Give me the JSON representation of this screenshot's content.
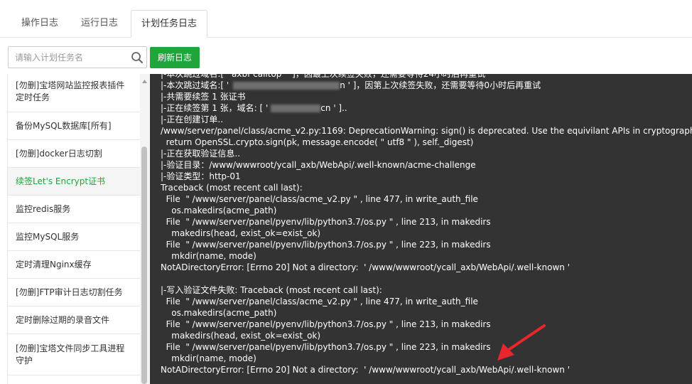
{
  "tabs": [
    {
      "label": "操作日志"
    },
    {
      "label": "运行日志"
    },
    {
      "label": "计划任务日志",
      "active": true
    }
  ],
  "search": {
    "placeholder": "请输入计划任务名",
    "icon": "search-icon"
  },
  "refresh_label": "刷新日志",
  "sidebar": {
    "items": [
      {
        "label": "[勿删]宝塔网站监控报表插件定时任务"
      },
      {
        "label": "备份MySQL数据库[所有]"
      },
      {
        "label": "[勿删]docker日志切割"
      },
      {
        "label": "续签Let's Encrypt证书",
        "selected": true
      },
      {
        "label": "监控redis服务"
      },
      {
        "label": "监控MySQL服务"
      },
      {
        "label": "定时清理Nginx缓存"
      },
      {
        "label": "[勿删]FTP审计日志切割任务"
      },
      {
        "label": "定时删除过期的录音文件"
      },
      {
        "label": "[勿删]宝塔文件同步工具进程守护"
      }
    ]
  },
  "log": {
    "lines": [
      "|-本次跳过域名:[ ' axbf calltop '  ]，因最上次续签失败，还需要等待24小时后再重试",
      "|-本次跳过域名:[ '",
      "n ' ]，因第上次续签失败，还需要等待0小时后再重试",
      "|-共需要续签 1 张证书",
      "|-正在续签第 1 张，域名: [ '",
      "cn ' ]..",
      "|-正在创建订单..",
      "/www/server/panel/class/acme_v2.py:1169: DeprecationWarning: sign() is deprecated. Use the equivilant APIs in cryptography.",
      "  return OpenSSL.crypto.sign(pk, message.encode( \" utf8 \" ), self._digest)",
      "|-正在获取验证信息..",
      "|-验证目录：/www/wwwroot/ycall_axb/WebApi/.well-known/acme-challenge",
      "|-验证类型：http-01",
      "Traceback (most recent call last):",
      "  File  \" /www/server/panel/class/acme_v2.py \" , line 477, in write_auth_file",
      "    os.makedirs(acme_path)",
      "  File  \" /www/server/panel/pyenv/lib/python3.7/os.py \" , line 213, in makedirs",
      "    makedirs(head, exist_ok=exist_ok)",
      "  File  \" /www/server/panel/pyenv/lib/python3.7/os.py \" , line 223, in makedirs",
      "    mkdir(name, mode)",
      "NotADirectoryError: [Errno 20] Not a directory:  ' /www/wwwroot/ycall_axb/WebApi/.well-known '",
      "",
      "|-写入验证文件失败: Traceback (most recent call last):",
      "  File  \" /www/server/panel/class/acme_v2.py \" , line 477, in write_auth_file",
      "    os.makedirs(acme_path)",
      "  File  \" /www/server/panel/pyenv/lib/python3.7/os.py \" , line 213, in makedirs",
      "    makedirs(head, exist_ok=exist_ok)",
      "  File  \" /www/server/panel/pyenv/lib/python3.7/os.py \" , line 223, in makedirs",
      "    mkdir(name, mode)",
      "NotADirectoryError: [Errno 20] Not a directory:  ' /www/wwwroot/ycall_axb/WebApi/.well-known '"
    ]
  },
  "colors": {
    "accent": "#20a53a",
    "log_bg": "#333333",
    "annotation_arrow": "#e8262b"
  }
}
